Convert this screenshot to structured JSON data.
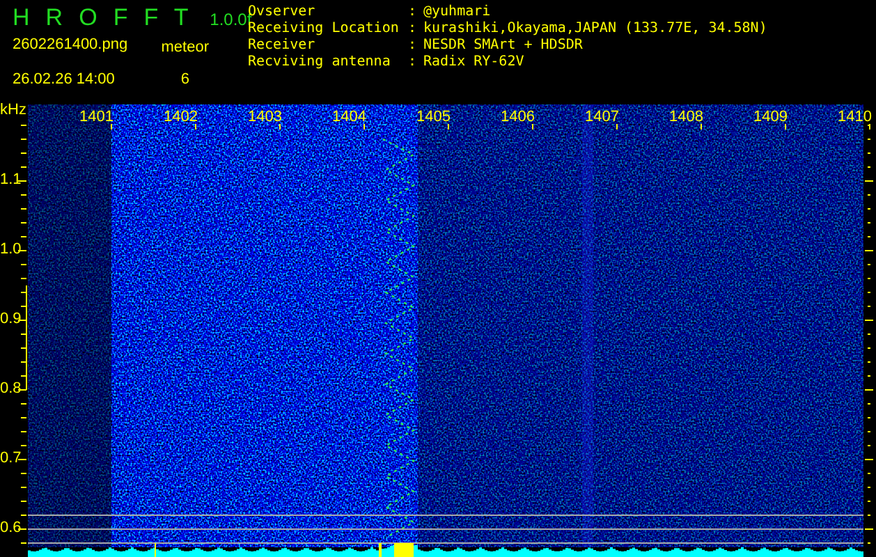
{
  "header": {
    "app_title": "H R O F F T",
    "version": "1.0.0f",
    "filename": "2602261400.png",
    "timestamp": "26.02.26 14:00",
    "meteor_label": "meteor",
    "meteor_count": "6"
  },
  "info": [
    {
      "label": "Ovserver",
      "separator": ":",
      "value": "@yuhmari"
    },
    {
      "label": "Receiving Location",
      "separator": ":",
      "value": "kurashiki,Okayama,JAPAN (133.77E, 34.58N)"
    },
    {
      "label": "Receiver",
      "separator": ":",
      "value": "NESDR SMArt + HDSDR"
    },
    {
      "label": "Recviving antenna",
      "separator": ":",
      "value": "Radix RY-62V"
    }
  ],
  "spectrogram": {
    "y_unit": "kHz",
    "x_labels": [
      "1401",
      "1402",
      "1403",
      "1404",
      "1405",
      "1406",
      "1407",
      "1408",
      "1409",
      "1410"
    ],
    "y_labels": [
      "1.1",
      "1.0",
      "0.9",
      "0.8",
      "0.7",
      "0.6"
    ]
  }
}
